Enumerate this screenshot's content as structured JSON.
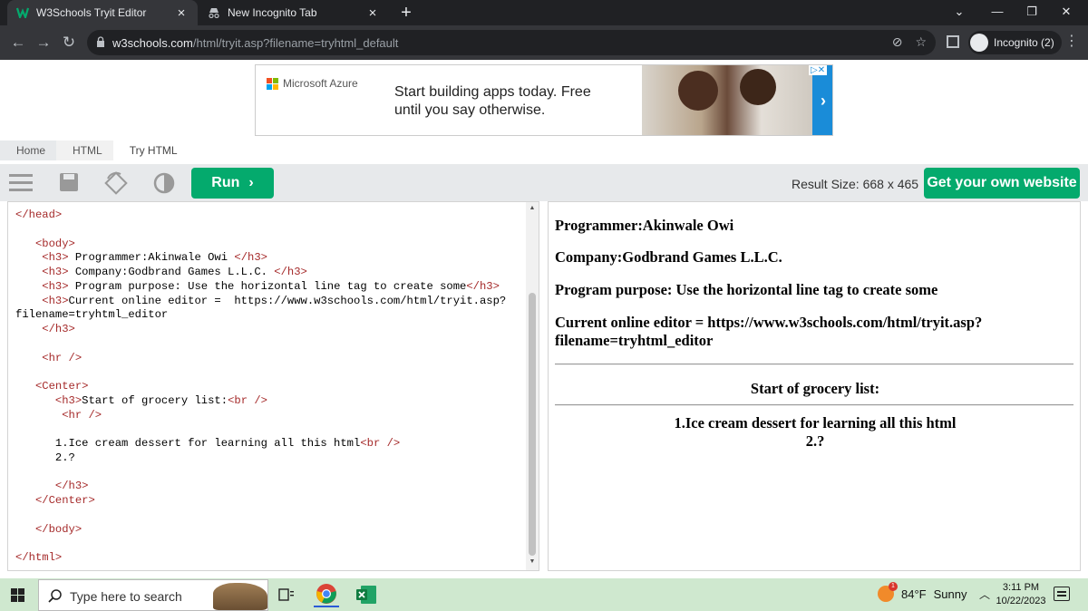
{
  "browser": {
    "tabs": [
      {
        "title": "W3Schools Tryit Editor",
        "active": true
      },
      {
        "title": "New Incognito Tab",
        "active": false
      }
    ],
    "new_tab": "+",
    "url_host": "w3schools.com",
    "url_path": "/html/tryit.asp?filename=tryhtml_default",
    "profile": "Incognito (2)"
  },
  "ad": {
    "brand": "Microsoft Azure",
    "headline_line1": "Start building apps today. Free",
    "headline_line2": "until you say otherwise.",
    "arrow": "›"
  },
  "breadcrumb": [
    "Home",
    "HTML",
    "Try HTML"
  ],
  "editor_toolbar": {
    "run_label": "Run",
    "result_size": "Result Size: 668 x 465",
    "get_own_label": "Get your own website"
  },
  "code_lines": [
    "</head>",
    "",
    "   <body>",
    "    <h3> Programmer:Akinwale Owi </h3>",
    "    <h3> Company:Godbrand Games L.L.C. </h3>",
    "    <h3> Program purpose: Use the horizontal line tag to create some</h3>",
    "    <h3>Current online editor =  https://www.w3schools.com/html/tryit.asp?",
    "filename=tryhtml_editor",
    "    </h3>",
    "",
    "    <hr />",
    "",
    "   <Center>",
    "      <h3>Start of grocery list:<br />",
    "       <hr />",
    "",
    "      1.Ice cream dessert for learning all this html<br />",
    "      2.?",
    "",
    "      </h3>",
    "   </Center>",
    "",
    "   </body>",
    "",
    "</html>"
  ],
  "result": {
    "programmer": "Programmer:Akinwale Owi",
    "company": "Company:Godbrand Games L.L.C.",
    "purpose": "Program purpose: Use the horizontal line tag to create some",
    "editor_line1": "Current online editor = https://www.w3schools.com/html/tryit.asp?",
    "editor_line2": "filename=tryhtml_editor",
    "grocery_title": "Start of grocery list:",
    "item1": "1.Ice cream dessert for learning all this html",
    "item2": "2.?"
  },
  "taskbar": {
    "search_placeholder": "Type here to search",
    "weather_temp": "84°F",
    "weather_desc": "Sunny",
    "weather_badge": "1",
    "time": "3:11 PM",
    "date": "10/22/2023"
  }
}
